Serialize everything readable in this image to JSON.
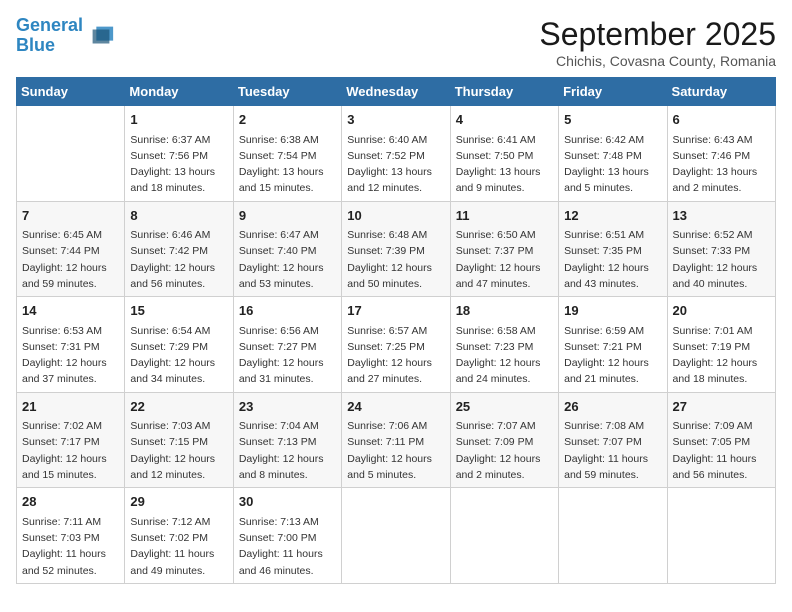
{
  "header": {
    "logo_line1": "General",
    "logo_line2": "Blue",
    "month": "September 2025",
    "location": "Chichis, Covasna County, Romania"
  },
  "weekdays": [
    "Sunday",
    "Monday",
    "Tuesday",
    "Wednesday",
    "Thursday",
    "Friday",
    "Saturday"
  ],
  "weeks": [
    [
      {
        "day": "",
        "info": ""
      },
      {
        "day": "1",
        "info": "Sunrise: 6:37 AM\nSunset: 7:56 PM\nDaylight: 13 hours\nand 18 minutes."
      },
      {
        "day": "2",
        "info": "Sunrise: 6:38 AM\nSunset: 7:54 PM\nDaylight: 13 hours\nand 15 minutes."
      },
      {
        "day": "3",
        "info": "Sunrise: 6:40 AM\nSunset: 7:52 PM\nDaylight: 13 hours\nand 12 minutes."
      },
      {
        "day": "4",
        "info": "Sunrise: 6:41 AM\nSunset: 7:50 PM\nDaylight: 13 hours\nand 9 minutes."
      },
      {
        "day": "5",
        "info": "Sunrise: 6:42 AM\nSunset: 7:48 PM\nDaylight: 13 hours\nand 5 minutes."
      },
      {
        "day": "6",
        "info": "Sunrise: 6:43 AM\nSunset: 7:46 PM\nDaylight: 13 hours\nand 2 minutes."
      }
    ],
    [
      {
        "day": "7",
        "info": "Sunrise: 6:45 AM\nSunset: 7:44 PM\nDaylight: 12 hours\nand 59 minutes."
      },
      {
        "day": "8",
        "info": "Sunrise: 6:46 AM\nSunset: 7:42 PM\nDaylight: 12 hours\nand 56 minutes."
      },
      {
        "day": "9",
        "info": "Sunrise: 6:47 AM\nSunset: 7:40 PM\nDaylight: 12 hours\nand 53 minutes."
      },
      {
        "day": "10",
        "info": "Sunrise: 6:48 AM\nSunset: 7:39 PM\nDaylight: 12 hours\nand 50 minutes."
      },
      {
        "day": "11",
        "info": "Sunrise: 6:50 AM\nSunset: 7:37 PM\nDaylight: 12 hours\nand 47 minutes."
      },
      {
        "day": "12",
        "info": "Sunrise: 6:51 AM\nSunset: 7:35 PM\nDaylight: 12 hours\nand 43 minutes."
      },
      {
        "day": "13",
        "info": "Sunrise: 6:52 AM\nSunset: 7:33 PM\nDaylight: 12 hours\nand 40 minutes."
      }
    ],
    [
      {
        "day": "14",
        "info": "Sunrise: 6:53 AM\nSunset: 7:31 PM\nDaylight: 12 hours\nand 37 minutes."
      },
      {
        "day": "15",
        "info": "Sunrise: 6:54 AM\nSunset: 7:29 PM\nDaylight: 12 hours\nand 34 minutes."
      },
      {
        "day": "16",
        "info": "Sunrise: 6:56 AM\nSunset: 7:27 PM\nDaylight: 12 hours\nand 31 minutes."
      },
      {
        "day": "17",
        "info": "Sunrise: 6:57 AM\nSunset: 7:25 PM\nDaylight: 12 hours\nand 27 minutes."
      },
      {
        "day": "18",
        "info": "Sunrise: 6:58 AM\nSunset: 7:23 PM\nDaylight: 12 hours\nand 24 minutes."
      },
      {
        "day": "19",
        "info": "Sunrise: 6:59 AM\nSunset: 7:21 PM\nDaylight: 12 hours\nand 21 minutes."
      },
      {
        "day": "20",
        "info": "Sunrise: 7:01 AM\nSunset: 7:19 PM\nDaylight: 12 hours\nand 18 minutes."
      }
    ],
    [
      {
        "day": "21",
        "info": "Sunrise: 7:02 AM\nSunset: 7:17 PM\nDaylight: 12 hours\nand 15 minutes."
      },
      {
        "day": "22",
        "info": "Sunrise: 7:03 AM\nSunset: 7:15 PM\nDaylight: 12 hours\nand 12 minutes."
      },
      {
        "day": "23",
        "info": "Sunrise: 7:04 AM\nSunset: 7:13 PM\nDaylight: 12 hours\nand 8 minutes."
      },
      {
        "day": "24",
        "info": "Sunrise: 7:06 AM\nSunset: 7:11 PM\nDaylight: 12 hours\nand 5 minutes."
      },
      {
        "day": "25",
        "info": "Sunrise: 7:07 AM\nSunset: 7:09 PM\nDaylight: 12 hours\nand 2 minutes."
      },
      {
        "day": "26",
        "info": "Sunrise: 7:08 AM\nSunset: 7:07 PM\nDaylight: 11 hours\nand 59 minutes."
      },
      {
        "day": "27",
        "info": "Sunrise: 7:09 AM\nSunset: 7:05 PM\nDaylight: 11 hours\nand 56 minutes."
      }
    ],
    [
      {
        "day": "28",
        "info": "Sunrise: 7:11 AM\nSunset: 7:03 PM\nDaylight: 11 hours\nand 52 minutes."
      },
      {
        "day": "29",
        "info": "Sunrise: 7:12 AM\nSunset: 7:02 PM\nDaylight: 11 hours\nand 49 minutes."
      },
      {
        "day": "30",
        "info": "Sunrise: 7:13 AM\nSunset: 7:00 PM\nDaylight: 11 hours\nand 46 minutes."
      },
      {
        "day": "",
        "info": ""
      },
      {
        "day": "",
        "info": ""
      },
      {
        "day": "",
        "info": ""
      },
      {
        "day": "",
        "info": ""
      }
    ]
  ]
}
